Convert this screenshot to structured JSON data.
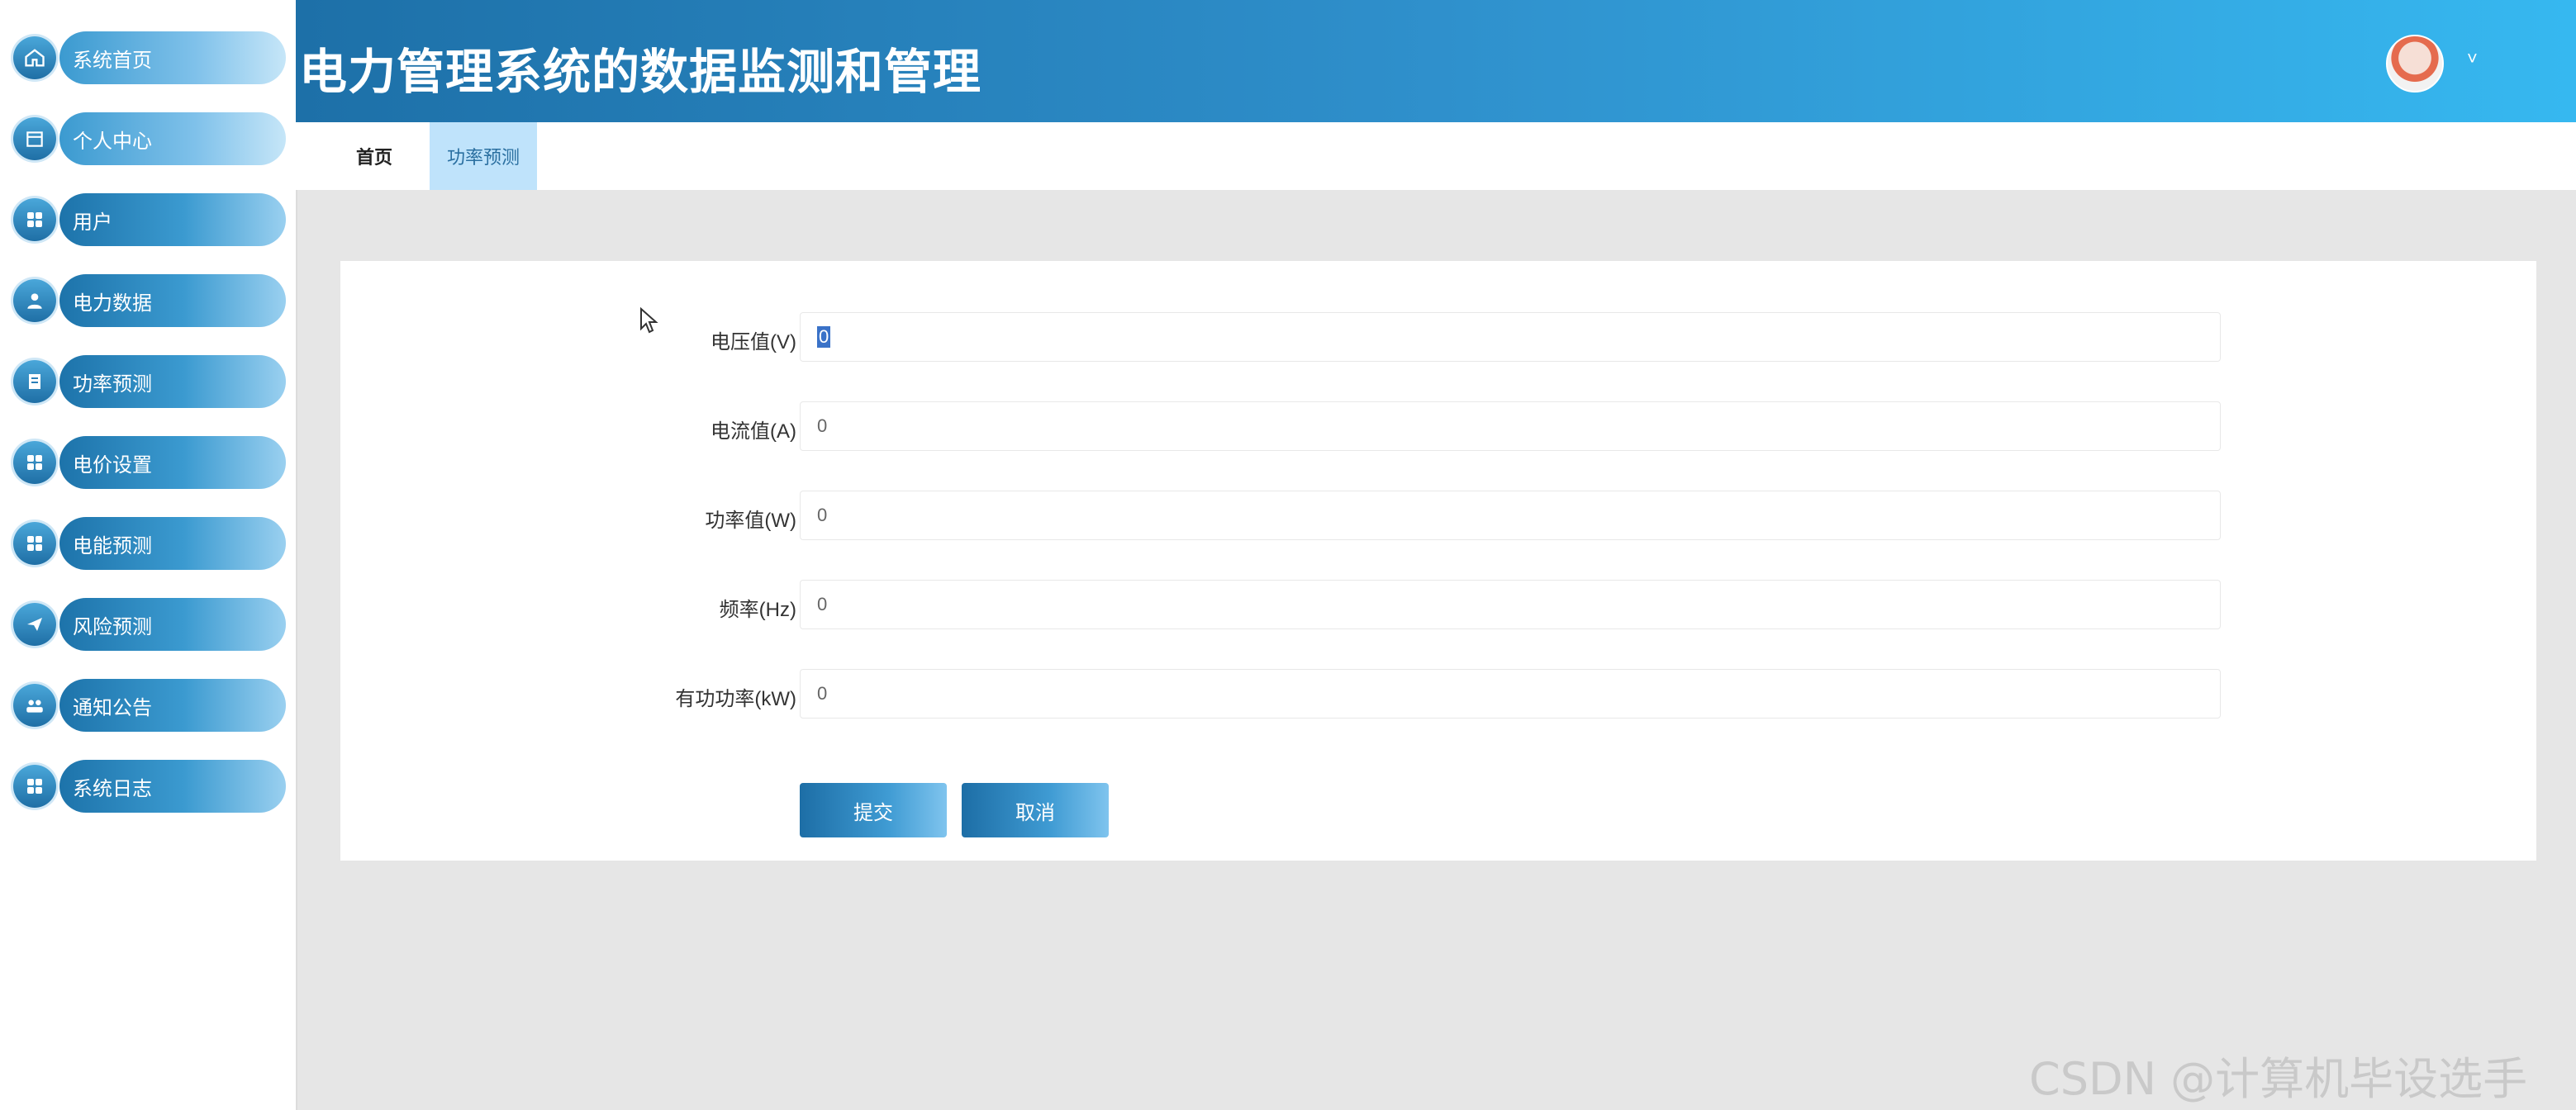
{
  "app": {
    "title": "电力管理系统的数据监测和管理"
  },
  "sidebar": {
    "items": [
      {
        "label": "系统首页",
        "icon": "home-icon"
      },
      {
        "label": "个人中心",
        "icon": "calendar-icon"
      },
      {
        "label": "用户",
        "icon": "grid-icon"
      },
      {
        "label": "电力数据",
        "icon": "user-icon"
      },
      {
        "label": "功率预测",
        "icon": "document-icon"
      },
      {
        "label": "电价设置",
        "icon": "grid-icon"
      },
      {
        "label": "电能预测",
        "icon": "grid-icon"
      },
      {
        "label": "风险预测",
        "icon": "send-icon"
      },
      {
        "label": "通知公告",
        "icon": "group-icon"
      },
      {
        "label": "系统日志",
        "icon": "grid-icon"
      }
    ]
  },
  "header": {
    "avatar": "avatar-image",
    "caret": "˅"
  },
  "tabs": [
    {
      "label": "首页",
      "active": false
    },
    {
      "label": "功率预测",
      "active": true
    }
  ],
  "form": {
    "fields": [
      {
        "label": "电压值(V)",
        "value": "0"
      },
      {
        "label": "电流值(A)",
        "value": "0"
      },
      {
        "label": "功率值(W)",
        "value": "0"
      },
      {
        "label": "频率(Hz)",
        "value": "0"
      },
      {
        "label": "有功功率(kW)",
        "value": "0"
      }
    ],
    "submit_label": "提交",
    "cancel_label": "取消"
  },
  "watermark": "CSDN @计算机毕设选手",
  "colors": {
    "header_start": "#1d70a8",
    "header_end": "#36b8f0",
    "active_tab": "#bfe3fb"
  }
}
